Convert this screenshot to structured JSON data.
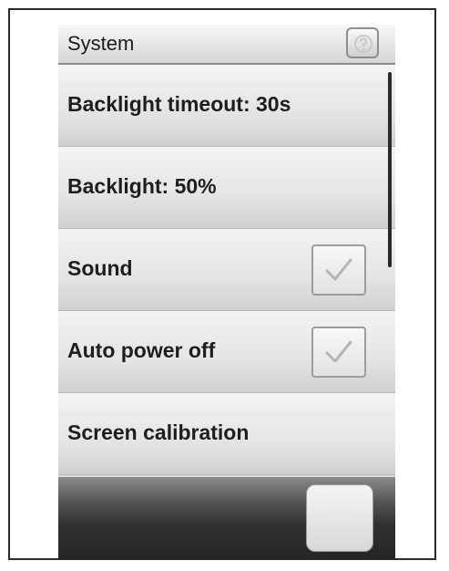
{
  "header": {
    "title": "System",
    "help_icon": "help-icon"
  },
  "settings": [
    {
      "label": "Backlight timeout: 30s",
      "type": "value"
    },
    {
      "label": "Backlight: 50%",
      "type": "value"
    },
    {
      "label": "Sound",
      "type": "checkbox",
      "checked": true
    },
    {
      "label": "Auto power off",
      "type": "checkbox",
      "checked": true
    },
    {
      "label": "Screen calibration",
      "type": "action"
    }
  ],
  "footer": {
    "button_icon": "back-icon"
  }
}
